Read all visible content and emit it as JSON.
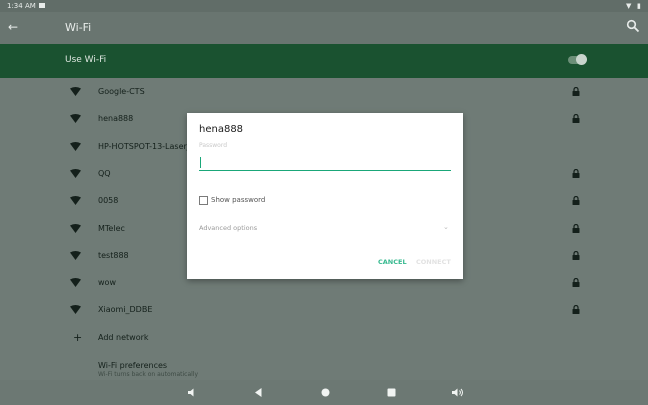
{
  "status_bar": {
    "time": "1:34 AM"
  },
  "app_bar": {
    "title": "Wi-Fi"
  },
  "use_wifi": {
    "label": "Use Wi-Fi",
    "enabled": true
  },
  "networks": [
    {
      "ssid": "Google-CTS",
      "locked": true
    },
    {
      "ssid": "hena888",
      "locked": true
    },
    {
      "ssid": "HP-HOTSPOT-13-LaserJet",
      "locked": false
    },
    {
      "ssid": "QQ",
      "locked": true
    },
    {
      "ssid": "0058",
      "locked": true
    },
    {
      "ssid": "MTelec",
      "locked": true
    },
    {
      "ssid": "test888",
      "locked": true
    },
    {
      "ssid": "wow",
      "locked": true
    },
    {
      "ssid": "Xiaomi_DDBE",
      "locked": true
    }
  ],
  "add_network": {
    "label": "Add network"
  },
  "wifi_prefs": {
    "title": "Wi-Fi preferences",
    "subtitle": "Wi-Fi turns back on automatically"
  },
  "dialog": {
    "title": "hena888",
    "password_hint": "Password",
    "password_value": "",
    "show_password_label": "Show password",
    "show_password_checked": false,
    "advanced_label": "Advanced options",
    "cancel_label": "CANCEL",
    "connect_label": "CONNECT"
  },
  "colors": {
    "accent": "#1aa779",
    "header_dark_green": "#1a5230"
  }
}
